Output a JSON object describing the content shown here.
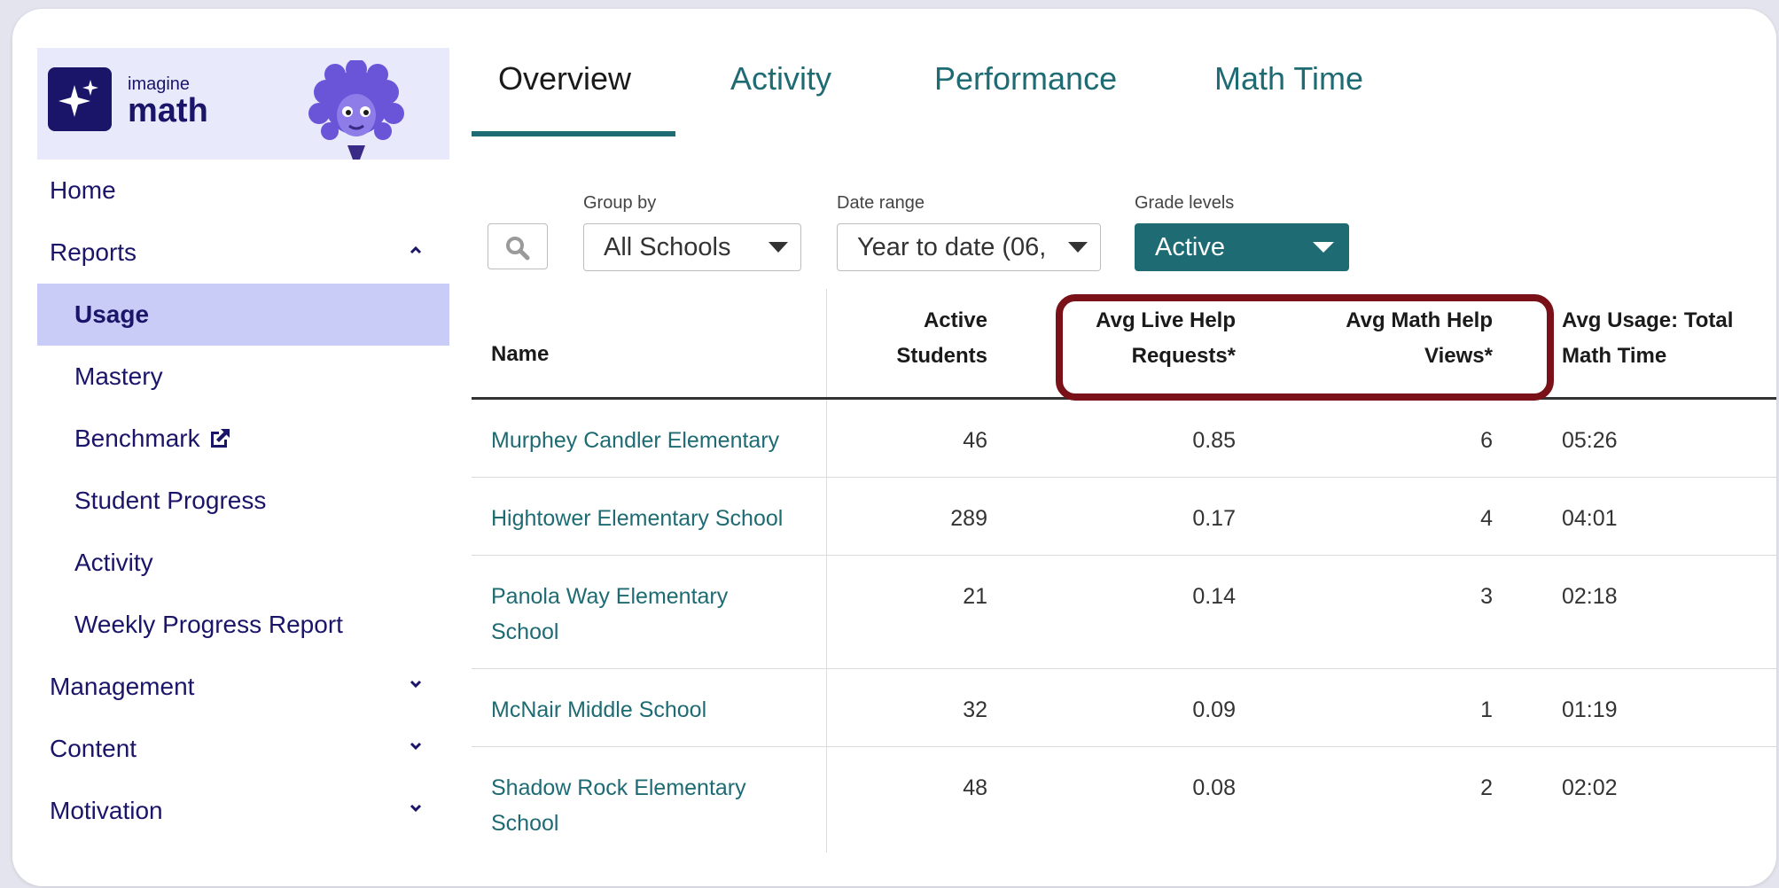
{
  "brand": {
    "line1": "imagine",
    "line2": "math"
  },
  "sidebar": {
    "items": [
      {
        "label": "Home",
        "level": "top",
        "selected": false,
        "chevron": ""
      },
      {
        "label": "Reports",
        "level": "top",
        "selected": false,
        "chevron": "up"
      },
      {
        "label": "Usage",
        "level": "sub",
        "selected": true,
        "chevron": ""
      },
      {
        "label": "Mastery",
        "level": "sub",
        "selected": false,
        "chevron": ""
      },
      {
        "label": "Benchmark",
        "level": "sub",
        "selected": false,
        "chevron": "",
        "external": true
      },
      {
        "label": "Student Progress",
        "level": "sub",
        "selected": false,
        "chevron": ""
      },
      {
        "label": "Activity",
        "level": "sub",
        "selected": false,
        "chevron": ""
      },
      {
        "label": "Weekly Progress Report",
        "level": "sub",
        "selected": false,
        "chevron": ""
      },
      {
        "label": "Management",
        "level": "top",
        "selected": false,
        "chevron": "down"
      },
      {
        "label": "Content",
        "level": "top",
        "selected": false,
        "chevron": "down"
      },
      {
        "label": "Motivation",
        "level": "top",
        "selected": false,
        "chevron": "down"
      }
    ]
  },
  "tabs": [
    {
      "label": "Overview",
      "active": true
    },
    {
      "label": "Activity",
      "active": false
    },
    {
      "label": "Performance",
      "active": false
    },
    {
      "label": "Math Time",
      "active": false
    }
  ],
  "filters": {
    "group_by": {
      "label": "Group by",
      "value": "All Schools"
    },
    "date_range": {
      "label": "Date range",
      "value": "Year to date (06,"
    },
    "grade_levels": {
      "label": "Grade levels",
      "value": "Active"
    }
  },
  "table": {
    "headers": {
      "name": "Name",
      "active_students": [
        "Active",
        "Students"
      ],
      "avg_live_help": [
        "Avg Live Help",
        "Requests*"
      ],
      "avg_math_help": [
        "Avg Math Help",
        "Views*"
      ],
      "avg_usage": [
        "Avg Usage: Total",
        "Math Time"
      ]
    },
    "rows": [
      {
        "name": [
          "Murphey Candler Elementary"
        ],
        "active_students": "46",
        "avg_live_help": "0.85",
        "avg_math_help": "6",
        "avg_usage": "05:26"
      },
      {
        "name": [
          "Hightower Elementary School"
        ],
        "active_students": "289",
        "avg_live_help": "0.17",
        "avg_math_help": "4",
        "avg_usage": "04:01"
      },
      {
        "name": [
          "Panola Way Elementary",
          "School"
        ],
        "active_students": "21",
        "avg_live_help": "0.14",
        "avg_math_help": "3",
        "avg_usage": "02:18"
      },
      {
        "name": [
          "McNair Middle School"
        ],
        "active_students": "32",
        "avg_live_help": "0.09",
        "avg_math_help": "1",
        "avg_usage": "01:19"
      },
      {
        "name": [
          "Shadow Rock Elementary",
          "School"
        ],
        "active_students": "48",
        "avg_live_help": "0.08",
        "avg_math_help": "2",
        "avg_usage": "02:02"
      }
    ]
  },
  "colors": {
    "brand_navy": "#1a1569",
    "accent_teal": "#1e6b73",
    "highlight_maroon": "#7a1018",
    "selected_bg": "#c9ccf7"
  }
}
